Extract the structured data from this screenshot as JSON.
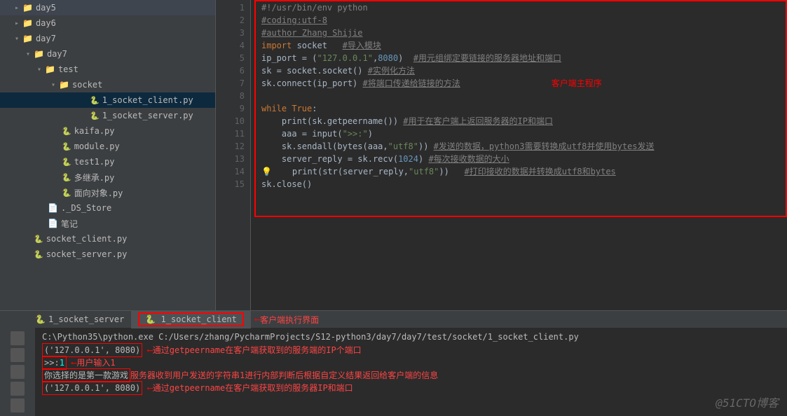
{
  "tree": {
    "day5": "day5",
    "day6": "day6",
    "day7": "day7",
    "day7_inner": "day7",
    "test": "test",
    "socket": "socket",
    "file_client": "1_socket_client.py",
    "file_server": "1_socket_server.py",
    "kaifa": "kaifa.py",
    "module": "module.py",
    "test1": "test1.py",
    "duojicheng": "多继承.py",
    "mianxiang": "面向对象.py",
    "dsstore": "._DS_Store",
    "biji": "笔记",
    "sc_client": "socket_client.py",
    "sc_server": "socket_server.py"
  },
  "code": {
    "l1": "#!/usr/bin/env python",
    "l2": "#coding:utf-8",
    "l3": "#author Zhang Shijie",
    "l4a": "import",
    "l4b": " socket   ",
    "l4c": "#导入模块",
    "l5a": "ip_port = (",
    "l5b": "\"127.0.0.1\"",
    "l5c": ",",
    "l5d": "8080",
    "l5e": ")  ",
    "l5f": "#用元组绑定要链接的服务器地址和端口",
    "l6a": "sk = socket.socket() ",
    "l6b": "#实例化方法",
    "l7a": "sk.connect(ip_port) ",
    "l7b": "#将端口传递给链接的方法",
    "l8": "",
    "l9a": "while ",
    "l9b": "True",
    "l9c": ":",
    "l10a": "    print(sk.getpeername()) ",
    "l10b": "#用于在客户端上返回服务器的IP和端口",
    "l11a": "    aaa = input(",
    "l11b": "\">>:\"",
    "l11c": ")",
    "l12a": "    sk.sendall(bytes(aaa,",
    "l12b": "\"utf8\"",
    "l12c": ")) ",
    "l12d": "#发送的数据，python3需要转换成utf8并使用bytes发送",
    "l13a": "    server_reply = sk.recv(",
    "l13b": "1024",
    "l13c": ") ",
    "l13d": "#每次接收数据的大小",
    "l14a": "    print(str(server_reply,",
    "l14b": "\"utf8\"",
    "l14c": "))   ",
    "l14d": "#打印接收的数据并转换成utf8和bytes",
    "l15": "sk.close()"
  },
  "annot": {
    "main": "客户端主程序",
    "exec": "客户端执行界面",
    "getpeer1": "通过getpeername在客户端获取到的服务端的IP个端口",
    "userinput": "用户输入1",
    "serverresp": "服务器收到用户发送的字符串1进行内部判断后根据自定义结果返回给客户端的信息",
    "getpeer2": "通过getpeername在客户端获取到的服务器IP和端口"
  },
  "tabs": {
    "server": "1_socket_server",
    "client": "1_socket_client"
  },
  "console": {
    "cmd": "C:\\Python35\\python.exe C:/Users/zhang/PycharmProjects/S12-python3/day7/day7/test/socket/1_socket_client.py",
    "o1": "('127.0.0.1', 8080)",
    "o2a": ">>:",
    "o2b": "1",
    "o3": "你选择的是第一款游戏",
    "o4": "('127.0.0.1', 8080)"
  },
  "watermark": "@51CTO博客"
}
